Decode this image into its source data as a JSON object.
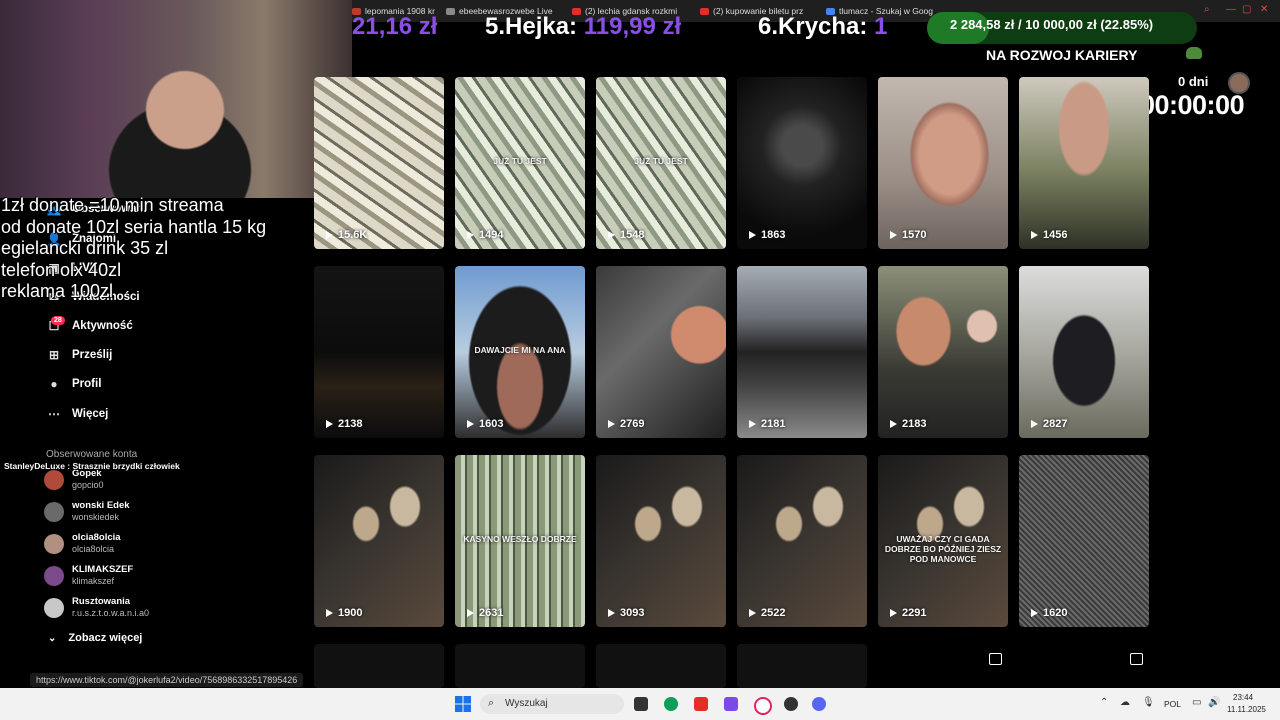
{
  "browser": {
    "tabs": [
      {
        "label": "lepomania 1908 kr",
        "color": "#c0392b"
      },
      {
        "label": "ebeebewasrozwebe Live",
        "color": "#8a8a8a"
      },
      {
        "label": "(2) lechia gdansk rozkmi",
        "color": "#e52d27"
      },
      {
        "label": "(2) kupowanie biletu prz",
        "color": "#e52d27"
      },
      {
        "label": "tlumacz - Szukaj w Goog",
        "color": "#4285f4"
      }
    ],
    "status_url": "https://www.tiktok.com/@jokerlufa2/video/7568986332517895426"
  },
  "overlay": {
    "ranking": [
      {
        "prefix": "",
        "amount": "21,16 zł"
      },
      {
        "prefix": "5.Hejka: ",
        "amount": "119,99 zł"
      },
      {
        "prefix": "6.Krycha: ",
        "amount": "1"
      }
    ],
    "goal": "2 284,58 zł / 10 000,00 zł (22.85%)",
    "goal_progress": 0.2285,
    "career": "NA ROZWOJ KARIERY",
    "days": "0 dni",
    "timer": "00:00:00",
    "donate_lines": [
      "1zł donate =10 min streama",
      "od donate 10zl seria hantla 15 kg",
      "egielancki drink 35 zl",
      "telefon olx 40zl",
      "reklama 100zl"
    ],
    "chat_line": "StanleyDeLuxe : Strasznie brzydki człowiek"
  },
  "sidebar": {
    "items": [
      {
        "label": "Obserwowani",
        "icon": "users-icon"
      },
      {
        "label": "Znajomi",
        "icon": "friends-icon"
      },
      {
        "label": "LIVE",
        "icon": "live-icon"
      },
      {
        "label": "Wiadomości",
        "icon": "messages-icon"
      },
      {
        "label": "Aktywność",
        "icon": "activity-icon",
        "badge": "28"
      },
      {
        "label": "Prześlij",
        "icon": "upload-icon"
      },
      {
        "label": "Profil",
        "icon": "profile-icon"
      },
      {
        "label": "Więcej",
        "icon": "more-icon"
      }
    ],
    "followed_title": "Obserwowane konta",
    "accounts": [
      {
        "name": "Gopek",
        "handle": "gopcio0",
        "color": "#b04a3a"
      },
      {
        "name": "wonski Edek",
        "handle": "wonskiedek",
        "color": "#6a6a6a"
      },
      {
        "name": "olcia8olcia",
        "handle": "olcia8olcia",
        "color": "#b09080"
      },
      {
        "name": "KLIMAKSZEF",
        "handle": "klimakszef",
        "color": "#7a4a8a"
      },
      {
        "name": "Rusztowania",
        "handle": "r.u.s.z.t.o.w.a.n.i.a0",
        "color": "#c8c8c8"
      }
    ],
    "see_more": "Zobacz więcej"
  },
  "videos": [
    {
      "views": "15.6K",
      "style": "money",
      "caption": ""
    },
    {
      "views": "1494",
      "style": "money2",
      "caption": "JUŻ TU JEST"
    },
    {
      "views": "1548",
      "style": "money2",
      "caption": "JUŻ TU JEST"
    },
    {
      "views": "1863",
      "style": "dark-street",
      "caption": ""
    },
    {
      "views": "1570",
      "style": "face-light",
      "caption": ""
    },
    {
      "views": "1456",
      "style": "face-green",
      "caption": ""
    },
    {
      "views": "2138",
      "style": "night-car",
      "caption": ""
    },
    {
      "views": "1603",
      "style": "hood-sky",
      "caption": "DAWAJCIE MI NA ANA"
    },
    {
      "views": "2769",
      "style": "car-interior",
      "caption": ""
    },
    {
      "views": "2181",
      "style": "street-car",
      "caption": ""
    },
    {
      "views": "2183",
      "style": "two-hoods",
      "caption": ""
    },
    {
      "views": "2827",
      "style": "park",
      "caption": ""
    },
    {
      "views": "1900",
      "style": "table-dark",
      "caption": ""
    },
    {
      "views": "2631",
      "style": "money-stack",
      "caption": "KASYNO WESZŁO DOBRZE"
    },
    {
      "views": "3093",
      "style": "table-dark",
      "caption": ""
    },
    {
      "views": "2522",
      "style": "table-dark",
      "caption": ""
    },
    {
      "views": "2291",
      "style": "table-dark",
      "caption": "UWAŻAJ CZY CI GADA DOBRZE BO PÓŹNIEJ ZIESZ POD MANOWCE"
    },
    {
      "views": "1620",
      "style": "fabric",
      "caption": ""
    }
  ],
  "taskbar": {
    "search_placeholder": "Wyszukaj",
    "language": "POL",
    "time": "23:44",
    "date": "11.11.2025"
  }
}
